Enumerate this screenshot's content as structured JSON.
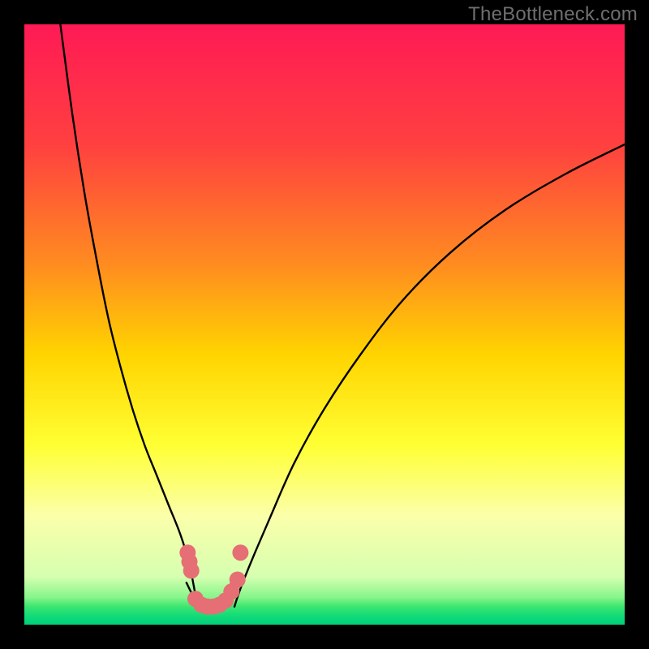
{
  "watermark": "TheBottleneck.com",
  "chart_data": {
    "type": "line",
    "title": "",
    "xlabel": "",
    "ylabel": "",
    "xlim": [
      0,
      100
    ],
    "ylim": [
      0,
      100
    ],
    "grid": false,
    "gradient_stops": [
      {
        "pos": 0.0,
        "color": "#ff1a55"
      },
      {
        "pos": 0.2,
        "color": "#ff4040"
      },
      {
        "pos": 0.4,
        "color": "#ff8c20"
      },
      {
        "pos": 0.55,
        "color": "#ffd400"
      },
      {
        "pos": 0.7,
        "color": "#ffff33"
      },
      {
        "pos": 0.82,
        "color": "#fbffaa"
      },
      {
        "pos": 0.92,
        "color": "#d6ffb0"
      },
      {
        "pos": 0.955,
        "color": "#85f58a"
      },
      {
        "pos": 0.97,
        "color": "#3ce670"
      },
      {
        "pos": 0.985,
        "color": "#12dc78"
      },
      {
        "pos": 1.0,
        "color": "#00d07a"
      }
    ],
    "series": [
      {
        "name": "left-branch",
        "x": [
          6,
          8,
          10,
          12,
          14,
          16,
          18,
          20,
          22,
          24,
          26,
          27.5,
          28.5,
          29
        ],
        "values": [
          100,
          85,
          72,
          61,
          51,
          43,
          36,
          30,
          25,
          20,
          15,
          10,
          5,
          3
        ]
      },
      {
        "name": "right-branch",
        "x": [
          35,
          36,
          38,
          41,
          45,
          50,
          56,
          63,
          71,
          80,
          90,
          100
        ],
        "values": [
          3,
          6,
          11,
          18,
          27,
          36,
          45,
          54,
          62,
          69,
          75,
          80
        ]
      },
      {
        "name": "valley-floor",
        "x": [
          27,
          28,
          29,
          30,
          31,
          32,
          33,
          34,
          35
        ],
        "values": [
          7,
          5,
          3.5,
          2.8,
          2.8,
          3,
          4,
          6,
          8
        ]
      }
    ],
    "markers": {
      "color": "#e56f74",
      "radius_px": 10,
      "points": [
        {
          "x": 27.2,
          "y": 12
        },
        {
          "x": 27.5,
          "y": 10.5
        },
        {
          "x": 27.8,
          "y": 9
        },
        {
          "x": 28.5,
          "y": 4.3
        },
        {
          "x": 29.5,
          "y": 3.3
        },
        {
          "x": 30.5,
          "y": 3
        },
        {
          "x": 31.5,
          "y": 3
        },
        {
          "x": 32.5,
          "y": 3.3
        },
        {
          "x": 33.5,
          "y": 4
        },
        {
          "x": 34.5,
          "y": 5.5
        },
        {
          "x": 35.5,
          "y": 7.5
        },
        {
          "x": 36,
          "y": 12
        }
      ]
    }
  }
}
